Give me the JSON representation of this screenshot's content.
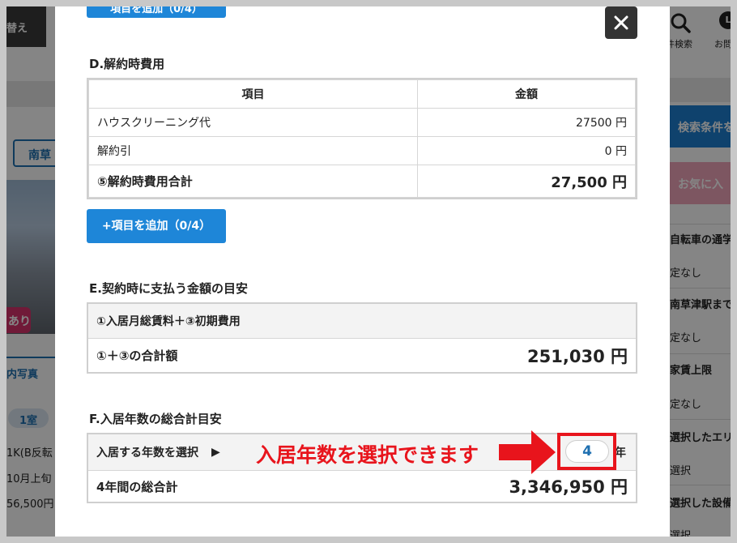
{
  "background": {
    "top_button": "替え",
    "station_button": "南草",
    "ari_badge": "あり",
    "photo_tab": "内写真",
    "room_badge": "1室",
    "listing_lines": [
      "1K(B反転",
      "10月上旬",
      "56,500円"
    ],
    "search_label": "件検索",
    "q_icon_text": "L",
    "q_label": "お問",
    "search_conditions_button": "検索条件を",
    "favorite_button": "お気に入",
    "right_items": [
      {
        "text": "自転車の通学",
        "bold": true
      },
      {
        "text": "定なし",
        "bold": false
      },
      {
        "text": "南草津駅まで",
        "bold": true
      },
      {
        "text": "定なし",
        "bold": false
      },
      {
        "text": "家賃上限",
        "bold": true
      },
      {
        "text": "定なし",
        "bold": false
      },
      {
        "text": "選択したエリ",
        "bold": true
      },
      {
        "text": "選択",
        "bold": false
      },
      {
        "text": "選択した設備",
        "bold": true
      },
      {
        "text": "選択",
        "bold": false
      }
    ]
  },
  "modal": {
    "top_button_partial": "項目を追加（0/4）",
    "section_d": {
      "title": "D.解約時費用",
      "col_item": "項目",
      "col_amount": "金額",
      "rows": [
        {
          "item": "ハウスクリーニング代",
          "amount": "27500 円"
        },
        {
          "item": "解約引",
          "amount": "0 円"
        }
      ],
      "total_label": "⑤解約時費用合計",
      "total_value": "27,500 円",
      "add_button": "+項目を追加（0/4）"
    },
    "section_e": {
      "title": "E.契約時に支払う金額の目安",
      "formula": "①入居月総賃料＋③初期費用",
      "total_label": "①＋③の合計額",
      "total_value": "251,030 円"
    },
    "section_f": {
      "title": "F.入居年数の総合計目安",
      "select_label": "入居する年数を選択",
      "select_marker": "▶",
      "annotation": "入居年数を選択できます",
      "selected_years": "4",
      "year_unit": "年",
      "total_label": "4年間の総合計",
      "total_value": "3,346,950 円"
    }
  },
  "colors": {
    "accent_blue": "#1e86d8",
    "annotation_red": "#e8141c"
  }
}
